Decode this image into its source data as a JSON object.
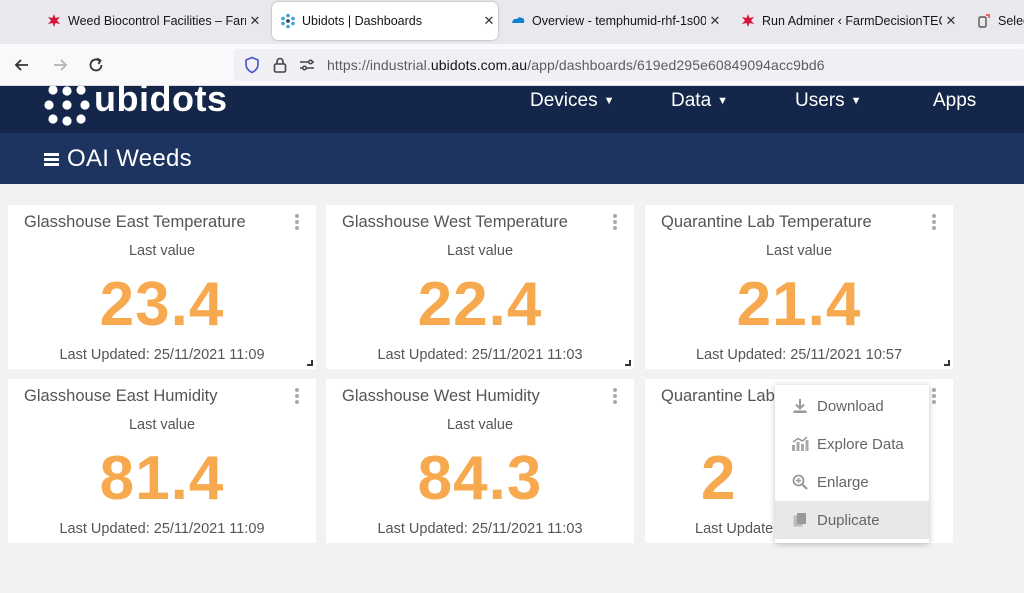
{
  "browser": {
    "tabs": [
      {
        "title": "Weed Biocontrol Facilities – Farm",
        "active": false,
        "icon": "nsw-icon"
      },
      {
        "title": "Ubidots | Dashboards",
        "active": true,
        "icon": "ubidots-icon"
      },
      {
        "title": "Overview - temphumid-rhf-1s00",
        "active": false,
        "icon": "ttn-icon"
      },
      {
        "title": "Run Adminer ‹ FarmDecisionTECH",
        "active": false,
        "icon": "nsw-icon"
      },
      {
        "title": "Select",
        "active": false,
        "icon": "page-icon"
      }
    ],
    "url_prefix": "https://industrial.",
    "url_domain": "ubidots.com.au",
    "url_path": "/app/dashboards/619ed295e60849094acc9bd6"
  },
  "app": {
    "logo_text": "ubidots",
    "menu": [
      {
        "label": "Devices",
        "has_caret": true
      },
      {
        "label": "Data",
        "has_caret": true
      },
      {
        "label": "Users",
        "has_caret": true
      },
      {
        "label": "Apps",
        "has_caret": false
      }
    ],
    "dashboard_title": "OAI Weeds"
  },
  "widgets": [
    {
      "title": "Glasshouse East Temperature",
      "subtitle": "Last value",
      "value": "23.4",
      "updated": "Last Updated: 25/11/2021 11:09"
    },
    {
      "title": "Glasshouse West Temperature",
      "subtitle": "Last value",
      "value": "22.4",
      "updated": "Last Updated: 25/11/2021 11:03"
    },
    {
      "title": "Quarantine Lab Temperature",
      "subtitle": "Last value",
      "value": "21.4",
      "updated": "Last Updated: 25/11/2021 10:57"
    },
    {
      "title": "Glasshouse East Humidity",
      "subtitle": "Last value",
      "value": "81.4",
      "updated": "Last Updated: 25/11/2021 11:09"
    },
    {
      "title": "Glasshouse West Humidity",
      "subtitle": "Last value",
      "value": "84.3",
      "updated": "Last Updated: 25/11/2021 11:03"
    },
    {
      "title": "Quarantine Lab",
      "subtitle": "",
      "value": "2",
      "updated": "Last Update"
    }
  ],
  "context_menu": {
    "items": [
      {
        "label": "Download",
        "icon": "download-icon"
      },
      {
        "label": "Explore Data",
        "icon": "chart-icon"
      },
      {
        "label": "Enlarge",
        "icon": "zoom-in-icon"
      },
      {
        "label": "Duplicate",
        "icon": "copy-icon"
      }
    ]
  },
  "colors": {
    "value": "#f7a950",
    "header": "#142649",
    "subheader": "#1d3460"
  }
}
